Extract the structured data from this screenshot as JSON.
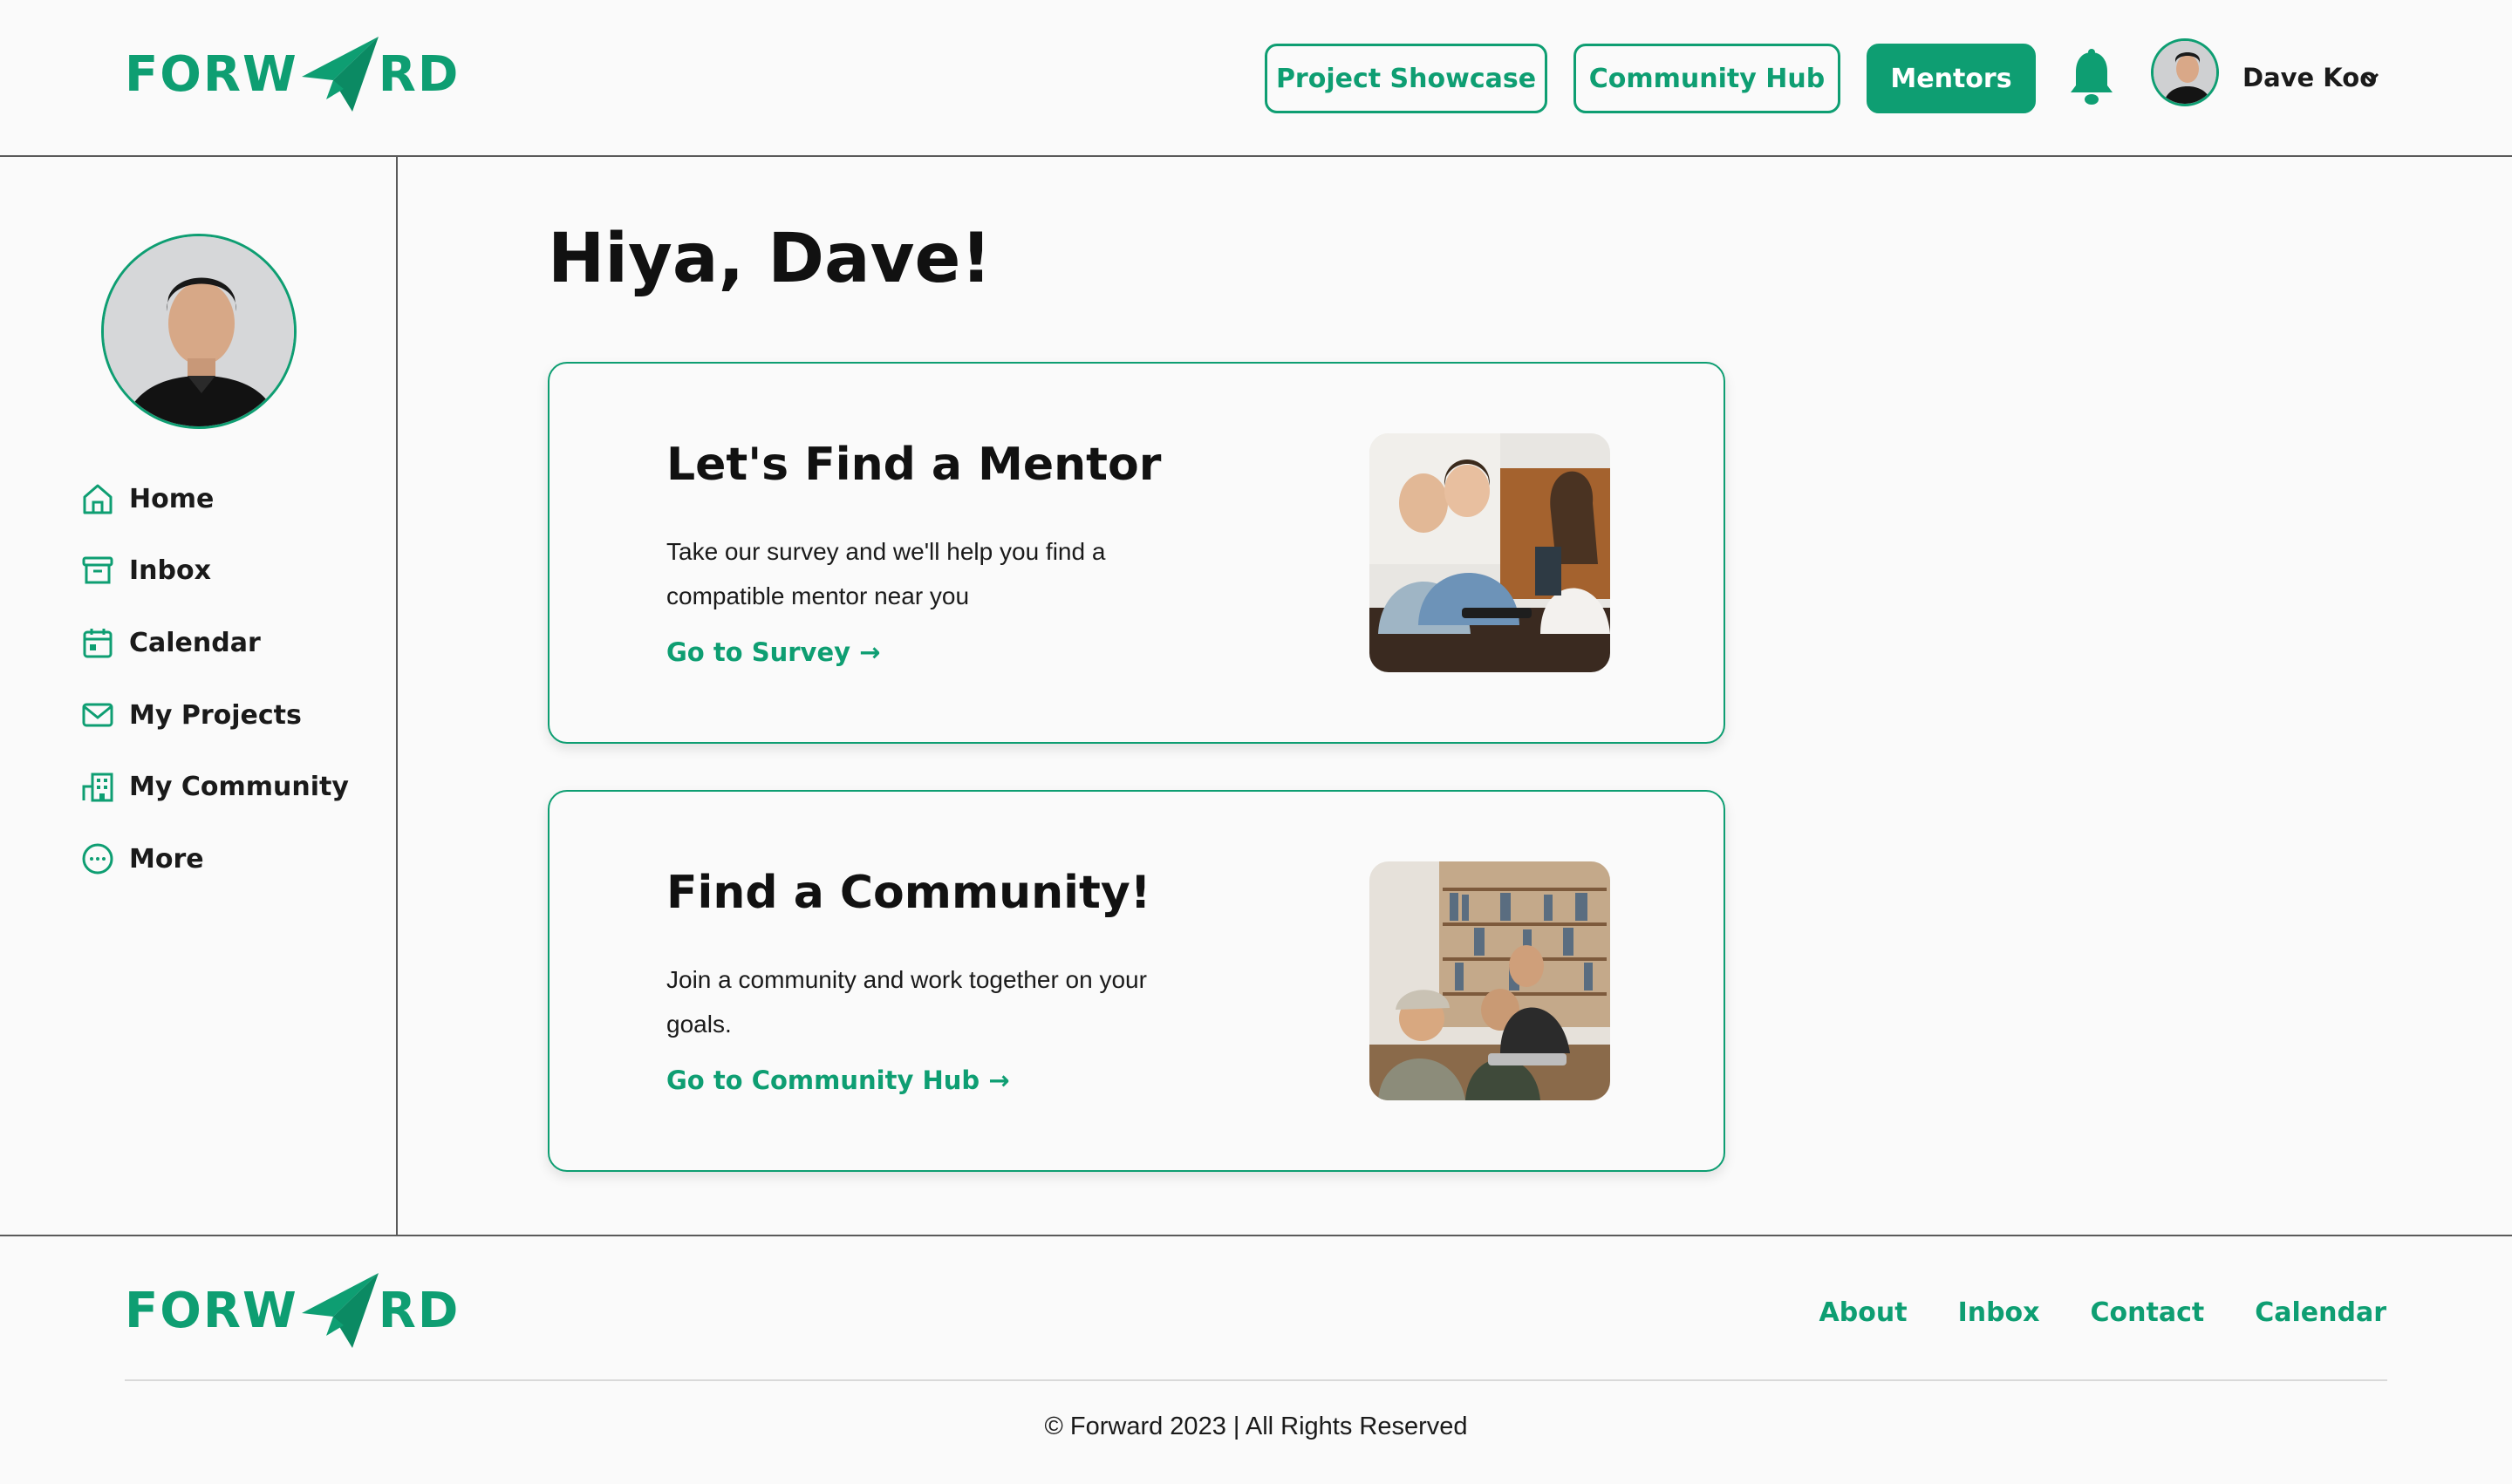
{
  "brand": {
    "logo_left": "FORW",
    "logo_right": "RD",
    "color": "#0e9e72"
  },
  "header": {
    "nav": [
      {
        "label": "Project Showcase"
      },
      {
        "label": "Community Hub"
      },
      {
        "label": "Mentors"
      }
    ],
    "user_name": "Dave Koo",
    "icons": {
      "bell": "bell-icon",
      "chevron": "chevron-down-icon"
    }
  },
  "sidebar": {
    "items": [
      {
        "label": "Home",
        "icon": "home-icon"
      },
      {
        "label": "Inbox",
        "icon": "inbox-icon"
      },
      {
        "label": "Calendar",
        "icon": "calendar-icon"
      },
      {
        "label": "My Projects",
        "icon": "mail-icon"
      },
      {
        "label": "My Community",
        "icon": "building-icon"
      },
      {
        "label": "More",
        "icon": "more-icon"
      }
    ]
  },
  "main": {
    "greeting": "Hiya, Dave!",
    "cards": [
      {
        "title": "Let's Find a Mentor",
        "description": "Take our survey and we'll help you find a compatible mentor near you",
        "link": "Go to Survey →"
      },
      {
        "title": "Find a Community!",
        "description": "Join a community and work together on your goals.",
        "link": "Go to Community Hub →"
      }
    ]
  },
  "footer": {
    "links": [
      {
        "label": "About"
      },
      {
        "label": "Inbox"
      },
      {
        "label": "Contact"
      },
      {
        "label": "Calendar"
      }
    ],
    "copyright": "© Forward 2023 | All Rights Reserved"
  }
}
